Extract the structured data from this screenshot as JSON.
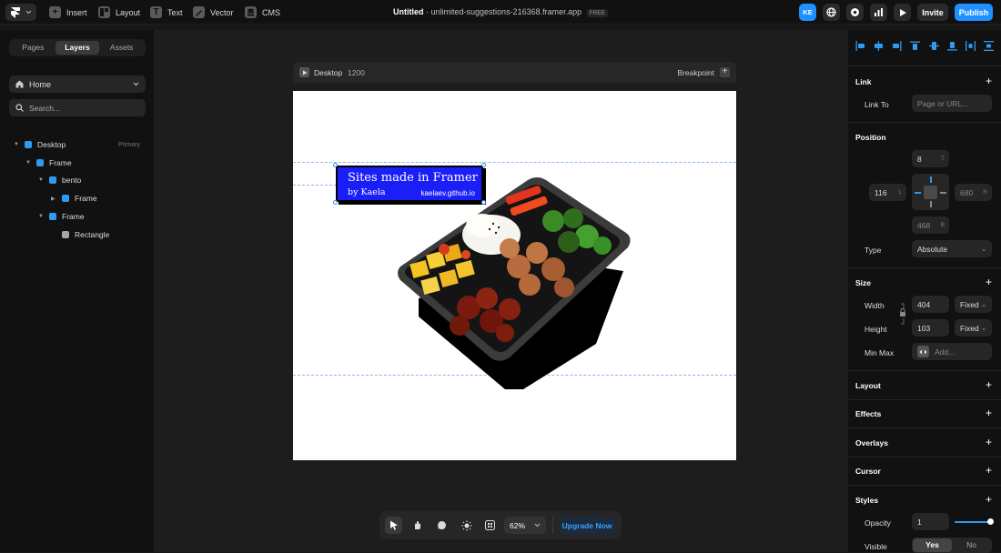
{
  "topbar": {
    "insert": "Insert",
    "layout": "Layout",
    "text": "Text",
    "vector": "Vector",
    "cms": "CMS",
    "project_title": "Untitled",
    "domain": "unlimited-suggestions-216368.framer.app",
    "plan_badge": "FREE",
    "avatar_initials": "KE",
    "invite": "Invite",
    "publish": "Publish",
    "accent": "#1e90ff"
  },
  "left_panel": {
    "tabs": [
      "Pages",
      "Layers",
      "Assets"
    ],
    "active_tab": "Layers",
    "page_selector": "Home",
    "search_placeholder": "Search...",
    "layers": [
      {
        "name": "Desktop",
        "badge": "Primary"
      },
      {
        "name": "Frame"
      },
      {
        "name": "bento"
      },
      {
        "name": "Frame"
      },
      {
        "name": "Frame"
      },
      {
        "name": "Rectangle"
      }
    ]
  },
  "canvas": {
    "frame_name": "Desktop",
    "frame_width": "1200",
    "breakpoint": "Breakpoint",
    "banner": {
      "title": "Sites made in Framer",
      "byline": "by Kaela",
      "url": "kaelaev.github.io",
      "background": "#1a1ff7"
    }
  },
  "bottom_toolbar": {
    "zoom": "62%",
    "upgrade": "Upgrade Now"
  },
  "right_panel": {
    "link": {
      "title": "Link",
      "link_to_label": "Link To",
      "placeholder": "Page or URL..."
    },
    "position": {
      "title": "Position",
      "top": "8",
      "top_unit": "T",
      "left": "116",
      "left_unit": "L",
      "right": "680",
      "right_unit": "R",
      "bottom": "468",
      "bottom_unit": "B",
      "type_label": "Type",
      "type_value": "Absolute"
    },
    "size": {
      "title": "Size",
      "width_label": "Width",
      "width": "404",
      "width_mode": "Fixed",
      "height_label": "Height",
      "height": "103",
      "height_mode": "Fixed",
      "minmax_label": "Min Max",
      "minmax_placeholder": "Add..."
    },
    "sections": [
      "Layout",
      "Effects",
      "Overlays",
      "Cursor",
      "Styles"
    ],
    "styles": {
      "opacity_label": "Opacity",
      "opacity": "1",
      "opacity_level": 1.0,
      "visible_label": "Visible",
      "visible_yes": "Yes",
      "visible_no": "No"
    }
  }
}
